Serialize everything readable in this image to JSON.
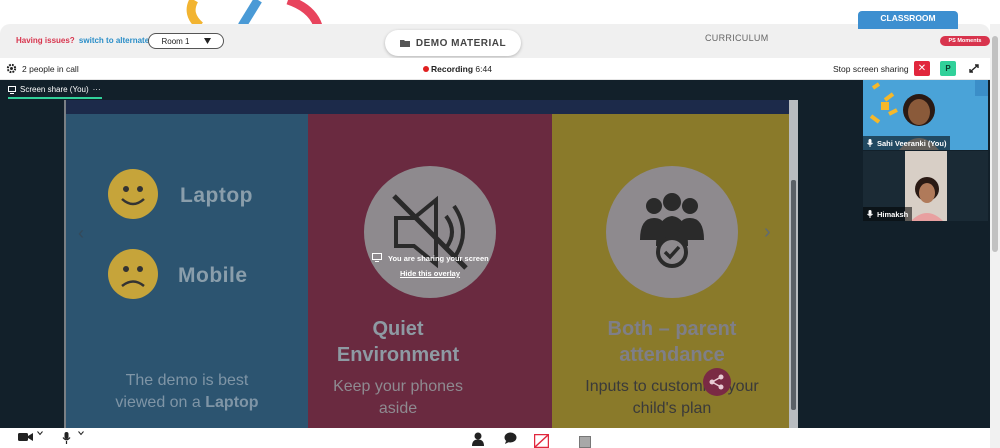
{
  "header": {
    "issues_text": "Having issues?",
    "switch_text": "switch to alternate room",
    "room_label": "Room 1",
    "demo_material_label": "DEMO MATERIAL",
    "curriculum_label": "CURRICULUM",
    "classroom_label": "CLASSROOM",
    "moments_label": "PS Moments"
  },
  "call_bar": {
    "people_text": "2 people in call",
    "recording_label": "Recording",
    "recording_time": "6:44",
    "stop_share_label": "Stop screen sharing",
    "close_label": "✕",
    "p_label": "P"
  },
  "stage": {
    "tab_label": "Screen share (You)",
    "tab_more": "···"
  },
  "slide": {
    "option1": "Laptop",
    "option2": "Mobile",
    "col1_line1": "The demo is best",
    "col1_line2_prefix": "viewed on a ",
    "col1_line2_bold": "Laptop",
    "col2_head_line1": "Quiet",
    "col2_head_line2": "Environment",
    "col2_sub_line1": "Keep your phones",
    "col2_sub_line2": "aside",
    "col3_head_line1": "Both – parent",
    "col3_head_line2": "attendance",
    "col3_sub_line1": "Inputs to customize your",
    "col3_sub_line2": "child's plan"
  },
  "overlay": {
    "message": "You are sharing your screen",
    "hide_link": "Hide this overlay"
  },
  "participants": [
    {
      "name": "Sahi Veeranki (You)"
    },
    {
      "name": "Himaksh"
    }
  ],
  "colors": {
    "accent_green": "#31d19a",
    "danger_red": "#e1273d",
    "classroom_blue": "#3d8fd0"
  }
}
